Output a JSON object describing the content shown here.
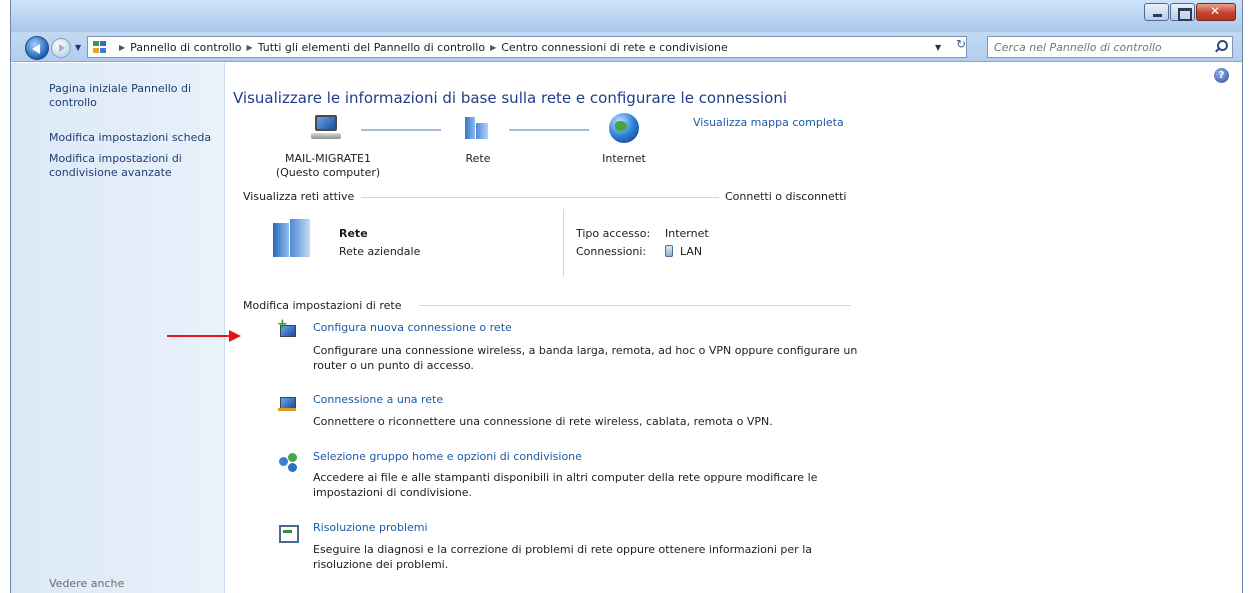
{
  "breadcrumb": [
    "Pannello di controllo",
    "Tutti gli elementi del Pannello di controllo",
    "Centro connessioni di rete e condivisione"
  ],
  "search": {
    "placeholder": "Cerca nel Pannello di controllo"
  },
  "sidebar": {
    "links": [
      "Pagina iniziale Pannello di controllo",
      "Modifica impostazioni scheda",
      "Modifica impostazioni di condivisione avanzate"
    ],
    "see_also": "Vedere anche"
  },
  "main": {
    "title": "Visualizzare le informazioni di base sulla rete e configurare le connessioni",
    "full_map_link": "Visualizza mappa completa",
    "map": {
      "computer_name": "MAIL-MIGRATE1",
      "computer_sub": "(Questo computer)",
      "network": "Rete",
      "internet": "Internet"
    },
    "active_networks": {
      "heading": "Visualizza reti attive",
      "connect_link": "Connetti o disconnetti",
      "network_name": "Rete",
      "network_type": "Rete aziendale",
      "access_type_label": "Tipo accesso:",
      "access_type_value": "Internet",
      "connections_label": "Connessioni:",
      "connections_value": "LAN"
    },
    "change_settings": {
      "heading": "Modifica impostazioni di rete",
      "tasks": [
        {
          "title": "Configura nuova connessione o rete",
          "description": "Configurare una connessione wireless, a banda larga, remota, ad hoc o VPN oppure configurare un router o un punto di accesso.",
          "icon": "network-setup-icon"
        },
        {
          "title": "Connessione a una rete",
          "description": "Connettere o riconnettere una connessione di rete wireless, cablata, remota o VPN.",
          "icon": "connect-network-icon"
        },
        {
          "title": "Selezione gruppo home e opzioni di condivisione",
          "description": "Accedere ai file e alle stampanti disponibili in altri computer della rete oppure modificare le impostazioni di condivisione.",
          "icon": "homegroup-icon"
        },
        {
          "title": "Risoluzione problemi",
          "description": "Eseguire la diagnosi e la correzione di problemi di rete oppure ottenere informazioni per la risoluzione dei problemi.",
          "icon": "troubleshoot-icon"
        }
      ]
    }
  },
  "colors": {
    "link": "#1c5aa6",
    "title": "#1e3e8c",
    "annotation": "#e8141b"
  }
}
